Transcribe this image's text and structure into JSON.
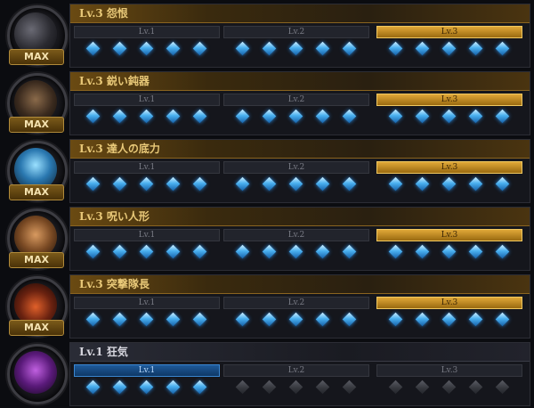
{
  "max_label": "MAX",
  "tier_labels": [
    "Lv.1",
    "Lv.2",
    "Lv.3"
  ],
  "colors": {
    "gold": "#e8c878",
    "gem_blue": "#4ab0f0",
    "active_tier": "#e0a838",
    "current_tier": "#1e5a9a"
  },
  "skills": [
    {
      "title": "Lv.3 怨恨",
      "portrait": "dark-demon-portrait",
      "maxed": true,
      "active_tier": 3,
      "gems_lit": [
        5,
        5,
        5
      ]
    },
    {
      "title": "Lv.3 鋭い鈍器",
      "portrait": "hooded-figure-portrait",
      "maxed": true,
      "active_tier": 3,
      "gems_lit": [
        5,
        5,
        5
      ]
    },
    {
      "title": "Lv.3 達人の底力",
      "portrait": "blue-specter-portrait",
      "maxed": true,
      "active_tier": 3,
      "gems_lit": [
        5,
        5,
        5
      ]
    },
    {
      "title": "Lv.3 呪い人形",
      "portrait": "cursed-doll-portrait",
      "maxed": true,
      "active_tier": 3,
      "gems_lit": [
        5,
        5,
        5
      ]
    },
    {
      "title": "Lv.3 突撃隊長",
      "portrait": "fiery-captain-portrait",
      "maxed": true,
      "active_tier": 3,
      "gems_lit": [
        5,
        5,
        5
      ]
    },
    {
      "title": "Lv.1 狂気",
      "portrait": "purple-madness-portrait",
      "maxed": false,
      "active_tier": 1,
      "gems_lit": [
        5,
        0,
        0
      ]
    }
  ]
}
